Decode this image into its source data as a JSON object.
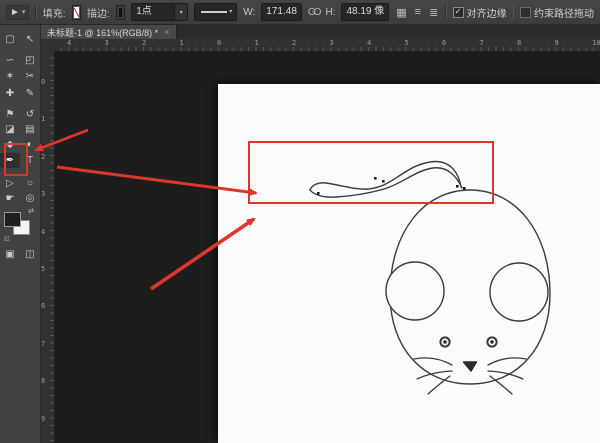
{
  "options_bar": {
    "tool_preset_icon": "►",
    "tool_preset_caret": "▾",
    "fill_label": "填充:",
    "stroke_label": "描边:",
    "stroke_width_value": "1点",
    "stroke_width_caret": "▾",
    "stroke_style_caret": "▾",
    "w_label": "W:",
    "w_value": "171.48",
    "link_icon": "GO",
    "h_label": "H:",
    "h_value": "48.19 像",
    "path_operations_icon": "▦",
    "path_alignment_icon": "≡",
    "path_arrangement_icon": "≣",
    "align_edges_label": "对齐边缘",
    "align_edges_checked": true,
    "align_edges_checkmark": "✓",
    "constrain_label": "约束路径拖动",
    "constrain_checked": false
  },
  "tab_bar": {
    "active_tab_title": "未标题-1 @ 161%(RGB/8) *",
    "close_label": "×"
  },
  "toolbar": {
    "selected_tool": "pen-tool",
    "rows": [
      [
        {
          "name": "rectangular-marquee-tool",
          "glyph": "▢"
        },
        {
          "name": "move-tool",
          "glyph": "↖"
        }
      ],
      [
        {
          "name": "lasso-tool",
          "glyph": "∽"
        },
        {
          "name": "crop-tool",
          "glyph": "◰"
        }
      ],
      [
        {
          "name": "magic-wand-tool",
          "glyph": "✶"
        },
        {
          "name": "slice-tool",
          "glyph": "✂"
        }
      ],
      [
        {
          "name": "healing-brush-tool",
          "glyph": "✚"
        },
        {
          "name": "brush-tool",
          "glyph": "✎"
        }
      ],
      [
        {
          "name": "clone-stamp-tool",
          "glyph": "⚑"
        },
        {
          "name": "history-brush-tool",
          "glyph": "↺"
        }
      ],
      [
        {
          "name": "eraser-tool",
          "glyph": "◪"
        },
        {
          "name": "gradient-tool",
          "glyph": "▤"
        }
      ],
      [
        {
          "name": "blur-tool",
          "glyph": "◆"
        },
        {
          "name": "dodge-tool",
          "glyph": "◐"
        }
      ],
      [
        {
          "name": "pen-tool",
          "glyph": "✒",
          "selected": true
        },
        {
          "name": "type-tool",
          "glyph": "T"
        }
      ],
      [
        {
          "name": "path-selection-tool",
          "glyph": "▷"
        },
        {
          "name": "shape-tool",
          "glyph": "○"
        }
      ],
      [
        {
          "name": "hand-tool",
          "glyph": "☛"
        },
        {
          "name": "zoom-tool",
          "glyph": "◎"
        }
      ]
    ],
    "bottom_row": [
      {
        "name": "quick-mask-button",
        "glyph": "▣"
      },
      {
        "name": "screen-mode-button",
        "glyph": "◫"
      }
    ],
    "swap_colors_glyph": "⇄",
    "default_colors_glyph": "◱"
  },
  "rulers": {
    "h_labels": [
      "4",
      "3",
      "2",
      "1",
      "0",
      "1",
      "2",
      "3",
      "4",
      "5",
      "6",
      "7",
      "8",
      "9",
      "10"
    ],
    "v_labels": [
      "0",
      "1",
      "2",
      "3",
      "4",
      "5",
      "6",
      "7",
      "8",
      "9"
    ]
  },
  "annotations": {
    "accent_color": "#df362c",
    "highlight": "pen-tool and drawn mouse tail"
  },
  "drawing": {
    "subject": "line sketch of a mouse with curved tail path",
    "line_color": "#3b3b3b",
    "canvas_color": "#fbfbfb"
  }
}
